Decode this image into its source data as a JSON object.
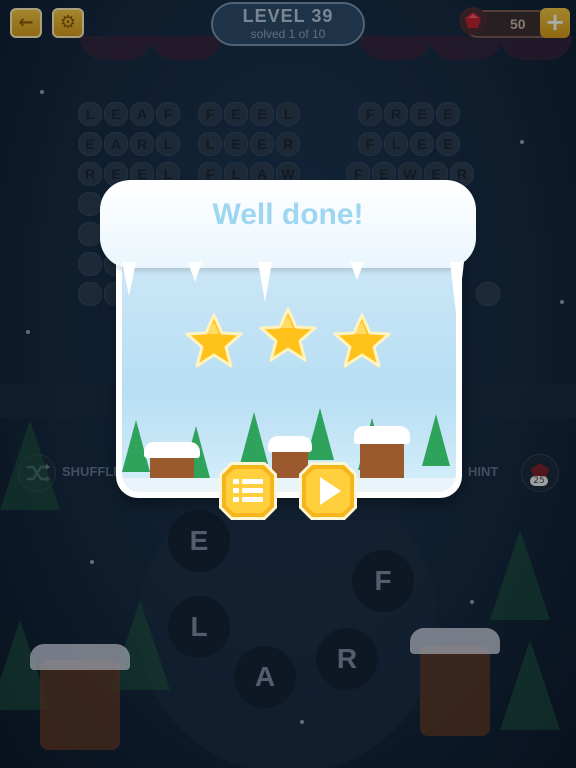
{
  "header": {
    "back_icon": "back-arrow-icon",
    "settings_icon": "gear-icon",
    "level_title": "LEVEL 39",
    "level_subtitle": "solved 1 of 10",
    "coins": "50",
    "plus_label": "+"
  },
  "words": [
    {
      "letters": [
        "L",
        "E",
        "A",
        "F"
      ]
    },
    {
      "letters": [
        "E",
        "A",
        "R",
        "L"
      ]
    },
    {
      "letters": [
        "R",
        "E",
        "E",
        "L"
      ]
    },
    {
      "letters": [
        "F",
        "E",
        "E",
        "L"
      ]
    },
    {
      "letters": [
        "L",
        "E",
        "E",
        "R"
      ]
    },
    {
      "letters": [
        "F",
        "L",
        "A",
        "W"
      ]
    },
    {
      "letters": [
        "F",
        "R",
        "E",
        "E"
      ]
    },
    {
      "letters": [
        "F",
        "L",
        "E",
        "E"
      ]
    },
    {
      "letters": [
        "F",
        "E",
        "W",
        "E",
        "R"
      ]
    }
  ],
  "controls": {
    "shuffle_label": "SHUFFLE",
    "hint_label": "HINT",
    "hint_cost": "25"
  },
  "wheel_letters": [
    "E",
    "F",
    "L",
    "R",
    "A"
  ],
  "modal": {
    "title": "Well done!",
    "stars_earned": 3,
    "stars_total": 3,
    "menu_button_icon": "list-icon",
    "next_button_icon": "play-icon"
  },
  "colors": {
    "title": "#9ed6f2",
    "star": "#ffc21a",
    "button_gold": "#f5b51c"
  }
}
